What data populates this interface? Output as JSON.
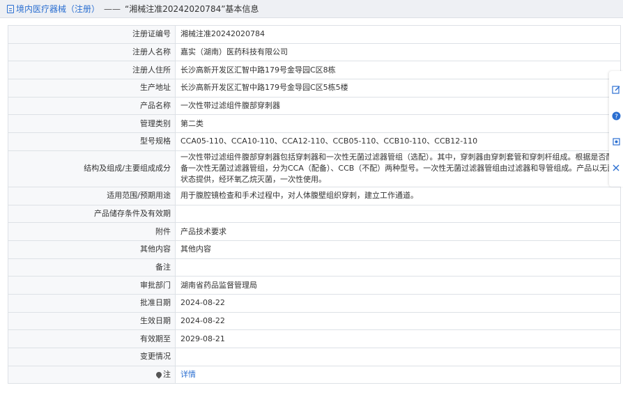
{
  "header": {
    "crumb": "境内医疗器械（注册）",
    "separator": "——",
    "title": "“湘械注准20242020784”基本信息"
  },
  "rows": [
    {
      "label": "注册证编号",
      "value": "湘械注准20242020784"
    },
    {
      "label": "注册人名称",
      "value": "嘉实（湖南）医药科技有限公司"
    },
    {
      "label": "注册人住所",
      "value": "长沙高新开发区汇智中路179号金导园C区8栋"
    },
    {
      "label": "生产地址",
      "value": "长沙高新开发区汇智中路179号金导园C区5栋5楼"
    },
    {
      "label": "产品名称",
      "value": "一次性带过滤组件腹部穿刺器"
    },
    {
      "label": "管理类别",
      "value": "第二类"
    },
    {
      "label": "型号规格",
      "value": "CCA05-110、CCA10-110、CCA12-110、CCB05-110、CCB10-110、CCB12-110"
    },
    {
      "label": "结构及组成/主要组成成分",
      "value": "一次性带过滤组件腹部穿刺器包括穿刺器和一次性无菌过滤器管组（选配）。其中，穿刺器由穿刺套管和穿刺杆组成。根据是否配备一次性无菌过滤器管组，分为CCA（配备）、CCB（不配）两种型号。一次性无菌过滤器管组由过滤器和导管组成。产品以无菌状态提供，经环氧乙烷灭菌，一次性使用。"
    },
    {
      "label": "适用范围/预期用途",
      "value": "用于腹腔镜检查和手术过程中，对人体腹壁组织穿刺，建立工作通道。"
    },
    {
      "label": "产品储存条件及有效期",
      "value": ""
    },
    {
      "label": "附件",
      "value": "产品技术要求"
    },
    {
      "label": "其他内容",
      "value": "其他内容"
    },
    {
      "label": "备注",
      "value": ""
    },
    {
      "label": "审批部门",
      "value": "湖南省药品监督管理局"
    },
    {
      "label": "批准日期",
      "value": "2024-08-22"
    },
    {
      "label": "生效日期",
      "value": "2024-08-22"
    },
    {
      "label": "有效期至",
      "value": "2029-08-21"
    },
    {
      "label": "变更情况",
      "value": ""
    },
    {
      "label": "注",
      "value": "详情"
    }
  ],
  "colors": {
    "link": "#2b6fd1",
    "label_bg": "#f7f8fa",
    "border": "#dde1e6"
  },
  "side_tools": [
    "edit-icon",
    "help-icon",
    "share-icon",
    "close-icon"
  ]
}
